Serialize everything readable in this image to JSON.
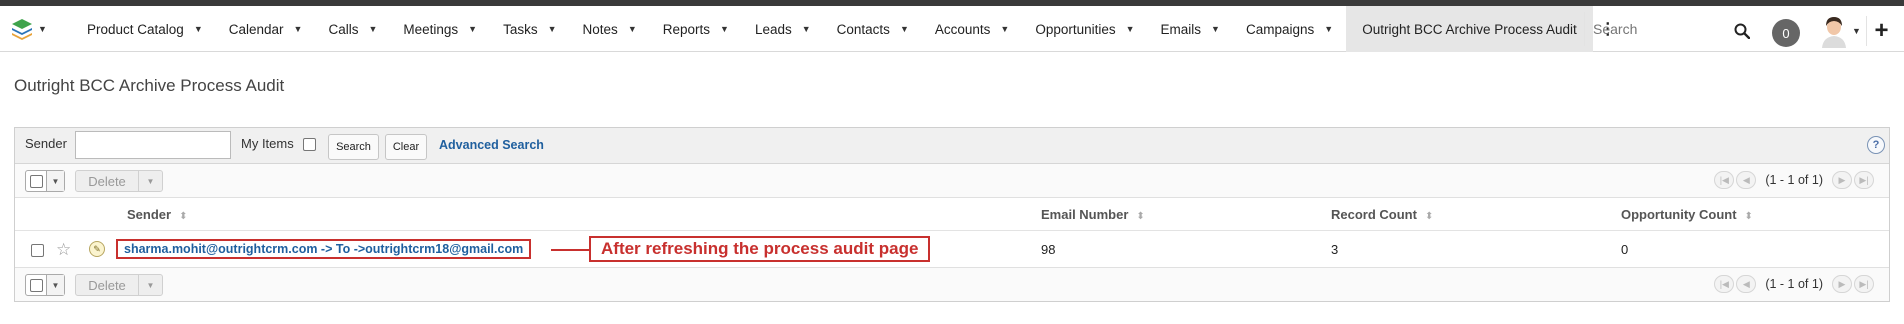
{
  "nav": {
    "items": [
      {
        "label": "Product Catalog",
        "dropdown": true
      },
      {
        "label": "Calendar",
        "dropdown": true
      },
      {
        "label": "Calls",
        "dropdown": true
      },
      {
        "label": "Meetings",
        "dropdown": true
      },
      {
        "label": "Tasks",
        "dropdown": true
      },
      {
        "label": "Notes",
        "dropdown": true
      },
      {
        "label": "Reports",
        "dropdown": true
      },
      {
        "label": "Leads",
        "dropdown": true
      },
      {
        "label": "Contacts",
        "dropdown": true
      },
      {
        "label": "Accounts",
        "dropdown": true
      },
      {
        "label": "Opportunities",
        "dropdown": true
      },
      {
        "label": "Emails",
        "dropdown": true
      },
      {
        "label": "Campaigns",
        "dropdown": true
      }
    ],
    "active_label": "Outright BCC Archive Process Audit",
    "search_placeholder": "Search",
    "notification_count": "0"
  },
  "page": {
    "title": "Outright BCC Archive Process Audit"
  },
  "filter": {
    "sender_label": "Sender",
    "sender_value": "",
    "my_items_label": "My Items",
    "search_button": "Search",
    "clear_button": "Clear",
    "advanced_search": "Advanced Search",
    "help": "?"
  },
  "actions": {
    "delete_label": "Delete",
    "pagination_text": "(1 - 1 of 1)"
  },
  "table": {
    "columns": [
      "Sender",
      "Email Number",
      "Record Count",
      "Opportunity Count"
    ],
    "rows": [
      {
        "sender": "sharma.mohit@outrightcrm.com -> To ->outrightcrm18@gmail.com",
        "email_number": "98",
        "record_count": "3",
        "opportunity_count": "0"
      }
    ]
  },
  "annotation": {
    "text": "After refreshing the process audit page",
    "color": "#c8302e"
  }
}
